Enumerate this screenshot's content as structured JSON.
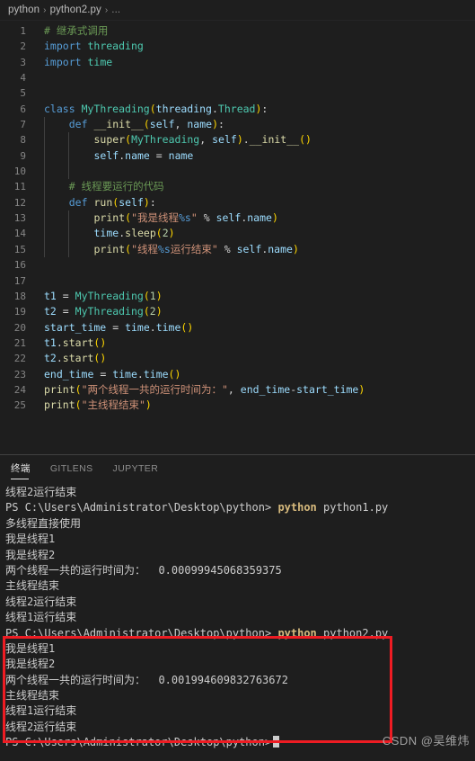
{
  "breadcrumb": {
    "items": [
      "python",
      "python2.py",
      "..."
    ],
    "separator": "›"
  },
  "editor": {
    "language": "python",
    "first_visible_line": 1,
    "lines": [
      {
        "n": "1",
        "text": "# 继承式调用"
      },
      {
        "n": "2",
        "text": "import threading"
      },
      {
        "n": "3",
        "text": "import time"
      },
      {
        "n": "4",
        "text": ""
      },
      {
        "n": "5",
        "text": ""
      },
      {
        "n": "6",
        "text": "class MyThreading(threading.Thread):"
      },
      {
        "n": "7",
        "text": "    def __init__(self, name):"
      },
      {
        "n": "8",
        "text": "        super(MyThreading, self).__init__()"
      },
      {
        "n": "9",
        "text": "        self.name = name"
      },
      {
        "n": "10",
        "text": ""
      },
      {
        "n": "11",
        "text": "    # 线程要运行的代码"
      },
      {
        "n": "12",
        "text": "    def run(self):"
      },
      {
        "n": "13",
        "text": "        print(\"我是线程%s\" % self.name)"
      },
      {
        "n": "14",
        "text": "        time.sleep(2)"
      },
      {
        "n": "15",
        "text": "        print(\"线程%s运行结束\" % self.name)"
      },
      {
        "n": "16",
        "text": ""
      },
      {
        "n": "17",
        "text": ""
      },
      {
        "n": "18",
        "text": "t1 = MyThreading(1)"
      },
      {
        "n": "19",
        "text": "t2 = MyThreading(2)"
      },
      {
        "n": "20",
        "text": "start_time = time.time()"
      },
      {
        "n": "21",
        "text": "t1.start()"
      },
      {
        "n": "22",
        "text": "t2.start()"
      },
      {
        "n": "23",
        "text": "end_time = time.time()"
      },
      {
        "n": "24",
        "text": "print(\"两个线程一共的运行时间为：\", end_time-start_time)"
      },
      {
        "n": "25",
        "text": "print(\"主线程结束\")"
      }
    ]
  },
  "panel": {
    "tabs": [
      {
        "label": "终端",
        "active": true
      },
      {
        "label": "GITLENS",
        "active": false
      },
      {
        "label": "JUPYTER",
        "active": false
      }
    ]
  },
  "terminal": {
    "prompt_path": "PS C:\\Users\\Administrator\\Desktop\\python>",
    "lines": [
      {
        "type": "out",
        "text": "线程2运行结束"
      },
      {
        "type": "prompt",
        "cmd": "python",
        "arg": "python1.py"
      },
      {
        "type": "out",
        "text": "多线程直接使用"
      },
      {
        "type": "out",
        "text": "我是线程1"
      },
      {
        "type": "out",
        "text": "我是线程2"
      },
      {
        "type": "out",
        "text": "两个线程一共的运行时间为：  0.00099945068359375"
      },
      {
        "type": "out",
        "text": "主线程结束"
      },
      {
        "type": "out",
        "text": "线程2运行结束"
      },
      {
        "type": "out",
        "text": "线程1运行结束"
      },
      {
        "type": "prompt",
        "cmd": "python",
        "arg": "python2.py"
      },
      {
        "type": "out",
        "text": "我是线程1"
      },
      {
        "type": "out",
        "text": "我是线程2"
      },
      {
        "type": "out",
        "text": "两个线程一共的运行时间为：  0.001994609832763672"
      },
      {
        "type": "out",
        "text": "主线程结束"
      },
      {
        "type": "out",
        "text": "线程1运行结束"
      },
      {
        "type": "out",
        "text": "线程2运行结束"
      },
      {
        "type": "cursor",
        "text": ""
      }
    ]
  },
  "annotation": {
    "highlight_color": "#ee1c23",
    "watermark": "CSDN @吴维炜"
  },
  "colors": {
    "editor_background": "#1e1e1e",
    "line_number": "#858585",
    "comment": "#6A9955",
    "keyword": "#569cd6",
    "string": "#CE9178",
    "function": "#DCDCAA",
    "class": "#4EC9B0",
    "variable": "#9CDCFE",
    "number": "#B5CEA8",
    "terminal_text": "#cccccc",
    "terminal_command": "#d7ba7d"
  }
}
